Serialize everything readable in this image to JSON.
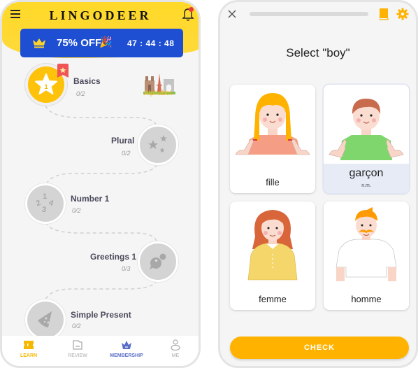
{
  "learn_screen": {
    "app_name": "LINGODEER",
    "promo": {
      "discount": "75% OFF",
      "party_emoji": "🎉",
      "countdown": "47 : 44 : 48"
    },
    "lessons": [
      {
        "title": "Basics",
        "progress": "0/2",
        "icon": "star-one-icon",
        "active": true,
        "number": "1"
      },
      {
        "title": "Plural",
        "progress": "0/2",
        "icon": "stars-icon",
        "active": false
      },
      {
        "title": "Number 1",
        "progress": "0/2",
        "icon": "numbers-icon",
        "active": false
      },
      {
        "title": "Greetings 1",
        "progress": "0/3",
        "icon": "chat-bubbles-icon",
        "active": false
      },
      {
        "title": "Simple Present",
        "progress": "0/2",
        "icon": "pizza-slice-icon",
        "active": false
      }
    ],
    "alphabet_label": "Alphabet",
    "tabs": [
      {
        "label": "LEARN",
        "icon": "learn-ticket-icon",
        "active": true
      },
      {
        "label": "REVIEW",
        "icon": "review-folder-icon",
        "active": false
      },
      {
        "label": "MEMBERSHIP",
        "icon": "membership-crown-icon",
        "active": false
      },
      {
        "label": "ME",
        "icon": "profile-icon",
        "active": false
      }
    ],
    "colors": {
      "header_yellow": "#ffd928",
      "promo_blue": "#1e4fd2",
      "active_yellow": "#ffc20a",
      "learn_tab": "#f5b800",
      "membership_tab": "#5a6fc7",
      "inactive_tab": "#aaaaaa"
    }
  },
  "quiz_screen": {
    "progress_fraction": 0.0,
    "prompt": "Select \"boy\"",
    "options": [
      {
        "word": "fille",
        "pos": "",
        "selected": false,
        "figure": "girl"
      },
      {
        "word": "garçon",
        "pos": "n.m.",
        "selected": true,
        "figure": "boy"
      },
      {
        "word": "femme",
        "pos": "",
        "selected": false,
        "figure": "woman"
      },
      {
        "word": "homme",
        "pos": "",
        "selected": false,
        "figure": "man"
      }
    ],
    "check_label": "CHECK",
    "colors": {
      "accent": "#ffb300",
      "selected_bg": "#e6ebf5"
    }
  }
}
